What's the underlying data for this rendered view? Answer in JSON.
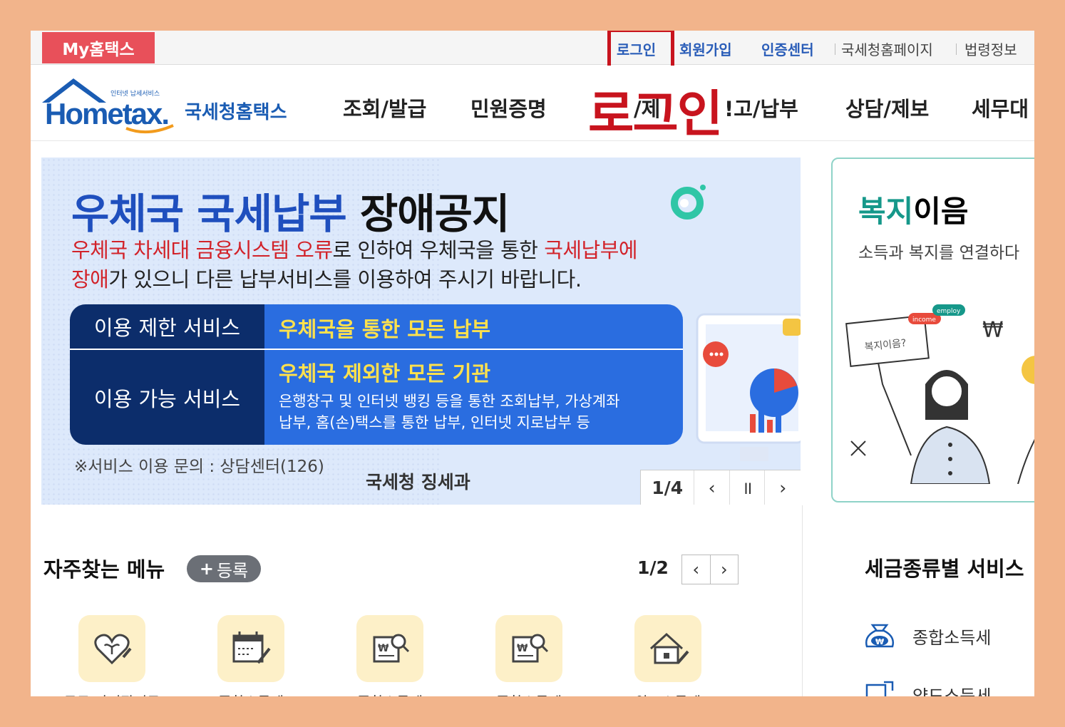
{
  "topbar": {
    "my_hometax": "My홈택스",
    "login": "로그인",
    "signup": "회원가입",
    "cert_center": "인증센터",
    "nts_home": "국세청홈페이지",
    "law_info": "법령정보"
  },
  "header": {
    "logo_small": "인터넷 납세서비스",
    "logo_main": "Hometax.",
    "logo_kr": "국세청홈택스",
    "nav": [
      "조회/발급",
      "민원증명",
      "신청/제출",
      "신고/납부",
      "상담/제보",
      "세무대리"
    ],
    "nav_visible": [
      "조회/발급",
      "민원증명",
      "/제",
      "!고/납부",
      "상담/제보",
      "세무대"
    ],
    "annotation": "로그인"
  },
  "banner": {
    "title_blue": "우체국 국세납부",
    "title_dark": "장애공지",
    "desc_red1": "우체국 차세대 금융시스템 오류",
    "desc_mid1": "로 인하여 우체국을 통한 ",
    "desc_red2": "국세납부에",
    "desc_red3": "장애",
    "desc_mid2": "가 있으니 다른 납부서비스를 이용하여 주시기 바랍니다.",
    "row1_label": "이용 제한 서비스",
    "row1_value": "우체국을 통한 모든 납부",
    "row2_label": "이용 가능 서비스",
    "row2_value": "우체국 제외한 모든 기관",
    "row2_detail1": "은행창구 및 인터넷 뱅킹 등을 통한 조회납부, 가상계좌",
    "row2_detail2": "납부, 홈(손)택스를 통한 납부, 인터넷 지로납부 등",
    "inquiry": "※서비스 이용 문의 : 상담센터(126)",
    "signature": "국세청 징세과",
    "page": "1/4",
    "prev": "‹",
    "pause": "॥",
    "next": "›"
  },
  "card": {
    "title_teal": "복지",
    "title_dark": "이음",
    "subtitle": "소득과 복지를 연결하다",
    "bubble": "복지이음?",
    "tag1": "income",
    "tag2": "employ"
  },
  "favorites": {
    "title": "자주찾는 메뉴",
    "register": "등록",
    "page": "1/2",
    "prev": "‹",
    "next": "›",
    "items": [
      "근로·자녀장려금",
      "종합소득세",
      "종합소득세",
      "종합소득세",
      "양도소득세"
    ]
  },
  "tax_service": {
    "title": "세금종류별 서비스",
    "items": [
      "종합소득세",
      "양도소득세"
    ]
  },
  "colors": {
    "frame": "#f2b48b",
    "accent_red": "#c8141e",
    "nav_blue": "#2a5db8",
    "banner_bg": "#dde9fb",
    "table_dark": "#0c2d6b",
    "table_blue": "#2a6de0"
  }
}
